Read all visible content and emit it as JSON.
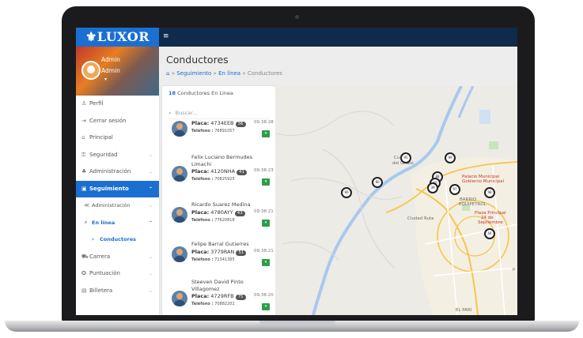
{
  "brand": {
    "logo_text": "LUXOR"
  },
  "profile": {
    "name": "Admin",
    "role": "Admin",
    "caret": "▾"
  },
  "sidebar": {
    "items": [
      {
        "icon": "user-icon",
        "glyph": "♙",
        "label": "Perfil"
      },
      {
        "icon": "logout-icon",
        "glyph": "⇥",
        "label": "Cerrar sesión"
      },
      {
        "icon": "home-icon",
        "glyph": "⌂",
        "label": "Principal"
      },
      {
        "icon": "key-icon",
        "glyph": "⚿",
        "label": "Seguridad",
        "chevron": "⌄"
      },
      {
        "icon": "users-icon",
        "glyph": "♣",
        "label": "Administración",
        "chevron": "⌄"
      },
      {
        "icon": "book-icon",
        "glyph": "▣",
        "label": "Seguimiento",
        "chevron": "⌃",
        "active": true
      },
      {
        "icon": "gear-icon",
        "glyph": "≪",
        "label": "Administración",
        "chevron": "⌄",
        "sub": true
      },
      {
        "icon": "online-icon",
        "glyph": "⚡",
        "label": "En línea",
        "chevron": "⌃",
        "sub": true
      },
      {
        "icon": "bullet-icon",
        "glyph": "›",
        "label": "Conductores",
        "sub2": true
      },
      {
        "icon": "car-icon",
        "glyph": "⛟",
        "label": "Carrera",
        "chevron": "⌄"
      },
      {
        "icon": "star-icon",
        "glyph": "✪",
        "label": "Puntuación",
        "chevron": "⌄"
      },
      {
        "icon": "wallet-icon",
        "glyph": "▤",
        "label": "Billetera",
        "chevron": "⌄"
      }
    ]
  },
  "topbar": {
    "menu_icon": "≡"
  },
  "page": {
    "title": "Conductores",
    "breadcrumb": {
      "home_icon": "⌂",
      "sep": "»",
      "items": [
        "Seguimiento",
        "En línea",
        "Conductores"
      ]
    }
  },
  "drivers_panel": {
    "count": "18",
    "count_label": "Conductores En Linea",
    "search_placeholder": "Buscar...",
    "search_icon": "⌕",
    "plate_label": "Placa:",
    "phone_label": "Teléfono :",
    "drivers": [
      {
        "name": "",
        "plate": "4734EEB",
        "badge": "36",
        "time": "09:38:28",
        "phone": "76891057"
      },
      {
        "name": "Felix Luciano Bermudes Limachi",
        "plate": "4120NHA",
        "badge": "41",
        "time": "09:38:23",
        "phone": "70825925"
      },
      {
        "name": "Ricardo Suarez Medina",
        "plate": "4780AYY",
        "badge": "43",
        "time": "09:38:21",
        "phone": "77620818"
      },
      {
        "name": "Felipe Barral Gutierres",
        "plate": "3779RAN",
        "badge": "51",
        "time": "09:38:21",
        "phone": "71341385"
      },
      {
        "name": "Steeven David Pinto Villagomez",
        "plate": "4729RFB",
        "badge": "75",
        "time": "09:38:20",
        "phone": "70882202"
      }
    ]
  },
  "map": {
    "labels": [
      {
        "text": "Cuadro",
        "cls": ""
      },
      {
        "text": "del Urubó",
        "cls": ""
      },
      {
        "text": "Palacio Municipal",
        "cls": "red"
      },
      {
        "text": "Gobierno Municipal",
        "cls": "red"
      },
      {
        "text": "BARRIO",
        "cls": ""
      },
      {
        "text": "EQUIPETROL",
        "cls": ""
      },
      {
        "text": "Plaza Principal",
        "cls": "red"
      },
      {
        "text": "24 de",
        "cls": "red"
      },
      {
        "text": "Septiembre",
        "cls": "red"
      },
      {
        "text": "EL PARI",
        "cls": ""
      },
      {
        "text": "Ciudad Ruta",
        "cls": ""
      },
      {
        "text": "P",
        "cls": ""
      }
    ],
    "markers": [
      "90",
      "80",
      "95",
      "99",
      "88",
      "60",
      "39",
      "97",
      "98",
      "64"
    ]
  },
  "colors": {
    "accent": "#1b6fd1",
    "topbar": "#0f2a4a",
    "success": "#2e9d4a"
  }
}
